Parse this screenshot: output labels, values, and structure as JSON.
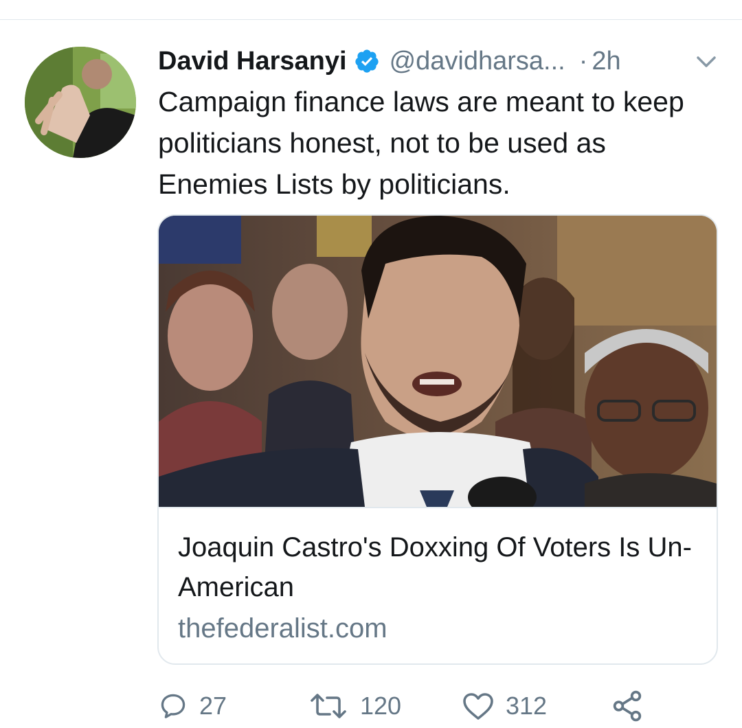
{
  "tweet": {
    "author_name": "David Harsanyi",
    "handle": "@davidharsa...",
    "separator": "·",
    "time": "2h",
    "text": "Campaign finance laws are meant to keep politicians honest, not to be used as Enemies Lists by politicians."
  },
  "card": {
    "title": "Joaquin Castro's Doxxing Of Voters Is Un-American",
    "domain": "thefederalist.com"
  },
  "actions": {
    "reply_count": "27",
    "retweet_count": "120",
    "like_count": "312"
  },
  "icons": {
    "verified": "verified-badge-icon",
    "caret": "chevron-down-icon",
    "reply": "reply-icon",
    "retweet": "retweet-icon",
    "like": "heart-icon",
    "share": "share-icon"
  },
  "colors": {
    "text": "#14171a",
    "secondary": "#657786",
    "verified": "#1da1f2",
    "border": "#e1e8ed"
  }
}
